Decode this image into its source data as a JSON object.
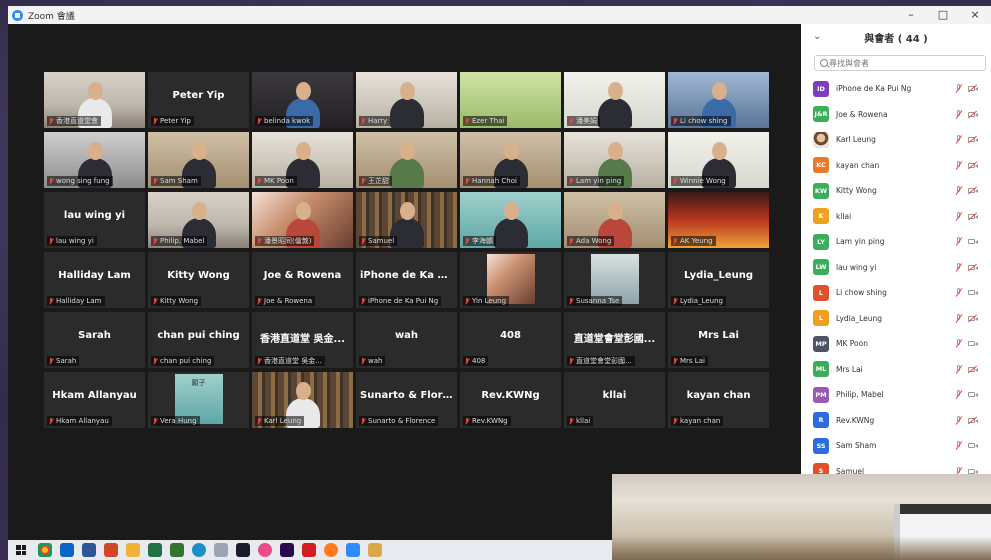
{
  "window": {
    "title": "Zoom 會議",
    "controls": [
      "–",
      "□",
      "×"
    ]
  },
  "gallery": {
    "tiles": [
      {
        "name": "香港直道堂會",
        "video": "v-wall",
        "person": "light",
        "active": true
      },
      {
        "name": "Peter Yip",
        "big": "Peter Yip"
      },
      {
        "name": "belinda kwok",
        "video": "v-dark",
        "person": "blue"
      },
      {
        "name": "Harry",
        "video": "v-room",
        "person": "dark"
      },
      {
        "name": "Ezer Thai",
        "video": "v-green",
        "person": "none"
      },
      {
        "name": "潘美娟",
        "video": "v-pale",
        "person": "dark"
      },
      {
        "name": "Li chow shing",
        "video": "v-blue",
        "person": "blue"
      },
      {
        "name": "wong sing fung",
        "video": "v-grey",
        "person": "dark"
      },
      {
        "name": "Sam Sham",
        "video": "v-warm",
        "person": "dark"
      },
      {
        "name": "MK Poon",
        "video": "v-room",
        "person": "dark"
      },
      {
        "name": "王芷甜",
        "video": "v-warm",
        "person": "green"
      },
      {
        "name": "Hannah Choi",
        "video": "v-warm",
        "person": "dark"
      },
      {
        "name": "Lam yin ping",
        "video": "v-room",
        "person": "green"
      },
      {
        "name": "Winnie Wong",
        "video": "v-pale",
        "person": "dark"
      },
      {
        "name": "lau wing yi",
        "big": "lau wing yi"
      },
      {
        "name": "Philip, Mabel",
        "video": "v-wall",
        "person": "dark"
      },
      {
        "name": "潘景昭同(倫敦)",
        "video": "v-rose",
        "person": "red"
      },
      {
        "name": "Samuel",
        "video": "v-shelf",
        "person": "dark"
      },
      {
        "name": "李海鵬",
        "video": "v-teal",
        "person": "dark"
      },
      {
        "name": "Ada Wong",
        "video": "v-warm",
        "person": "red"
      },
      {
        "name": "AK Yeung",
        "video": "v-city",
        "person": "none"
      },
      {
        "name": "Halliday Lam",
        "big": "Halliday Lam"
      },
      {
        "name": "Kitty Wong",
        "big": "Kitty Wong"
      },
      {
        "name": "Joe & Rowena",
        "big": "Joe & Rowena"
      },
      {
        "name": "iPhone de Ka Pui Ng",
        "big": "iPhone de Ka Pu..."
      },
      {
        "name": "Yin Leung",
        "card": "v-rose"
      },
      {
        "name": "Susanna Tse",
        "card": "v-kitchen"
      },
      {
        "name": "Lydia_Leung",
        "big": "Lydia_Leung"
      },
      {
        "name": "Sarah",
        "big": "Sarah"
      },
      {
        "name": "chan pui ching",
        "big": "chan pui ching"
      },
      {
        "name": "香港直道堂 吳金...",
        "big": "香港直道堂 吳金..."
      },
      {
        "name": "wah",
        "big": "wah"
      },
      {
        "name": "408",
        "big": "408"
      },
      {
        "name": "直道堂會堂彭國...",
        "big": "直道堂會堂彭國..."
      },
      {
        "name": "Mrs Lai",
        "big": "Mrs Lai"
      },
      {
        "name": "Hkam Allanyau",
        "big": "Hkam Allanyau"
      },
      {
        "name": "Vera Hung",
        "card": "v-teal",
        "kanji": "願子"
      },
      {
        "name": "Karl Leung",
        "video": "v-shelf",
        "person": "light"
      },
      {
        "name": "Sunarto & Florence",
        "big": "Sunarto & Flore..."
      },
      {
        "name": "Rev.KWNg",
        "big": "Rev.KWNg"
      },
      {
        "name": "kllai",
        "big": "kllai"
      },
      {
        "name": "kayan chan",
        "big": "kayan chan"
      }
    ]
  },
  "participants": {
    "title": "與會者 ( 44 )",
    "search_placeholder": "尋找與會者",
    "items": [
      {
        "initials": "ID",
        "name": "iPhone de Ka Pui Ng",
        "color": "#7b3fbe",
        "cam": "off"
      },
      {
        "initials": "J&R",
        "name": "Joe & Rowena",
        "color": "#3aae5a",
        "cam": "off"
      },
      {
        "initials": "",
        "name": "Karl Leung",
        "color": "photo",
        "cam": "off"
      },
      {
        "initials": "KC",
        "name": "kayan chan",
        "color": "#e8782a",
        "cam": "off"
      },
      {
        "initials": "KW",
        "name": "Kitty Wong",
        "color": "#3aae5a",
        "cam": "off"
      },
      {
        "initials": "K",
        "name": "kllai",
        "color": "#f0a020",
        "cam": "off"
      },
      {
        "initials": "LY",
        "name": "Lam yin ping",
        "color": "#3aae5a",
        "cam": "on"
      },
      {
        "initials": "LW",
        "name": "lau wing yi",
        "color": "#3aae5a",
        "cam": "off"
      },
      {
        "initials": "L",
        "name": "Li chow shing",
        "color": "#e0502a",
        "cam": "on"
      },
      {
        "initials": "L",
        "name": "Lydia_Leung",
        "color": "#f0a020",
        "cam": "off"
      },
      {
        "initials": "MP",
        "name": "MK Poon",
        "color": "#4b5563",
        "cam": "on"
      },
      {
        "initials": "ML",
        "name": "Mrs Lai",
        "color": "#3aae5a",
        "cam": "off"
      },
      {
        "initials": "PM",
        "name": "Philip, Mabel",
        "color": "#9b59b6",
        "cam": "on"
      },
      {
        "initials": "R",
        "name": "Rev.KWNg",
        "color": "#2d6cdf",
        "cam": "off"
      },
      {
        "initials": "SS",
        "name": "Sam Sham",
        "color": "#2d6cdf",
        "cam": "on"
      },
      {
        "initials": "S",
        "name": "Samuel",
        "color": "#e0502a",
        "cam": "on"
      }
    ]
  }
}
